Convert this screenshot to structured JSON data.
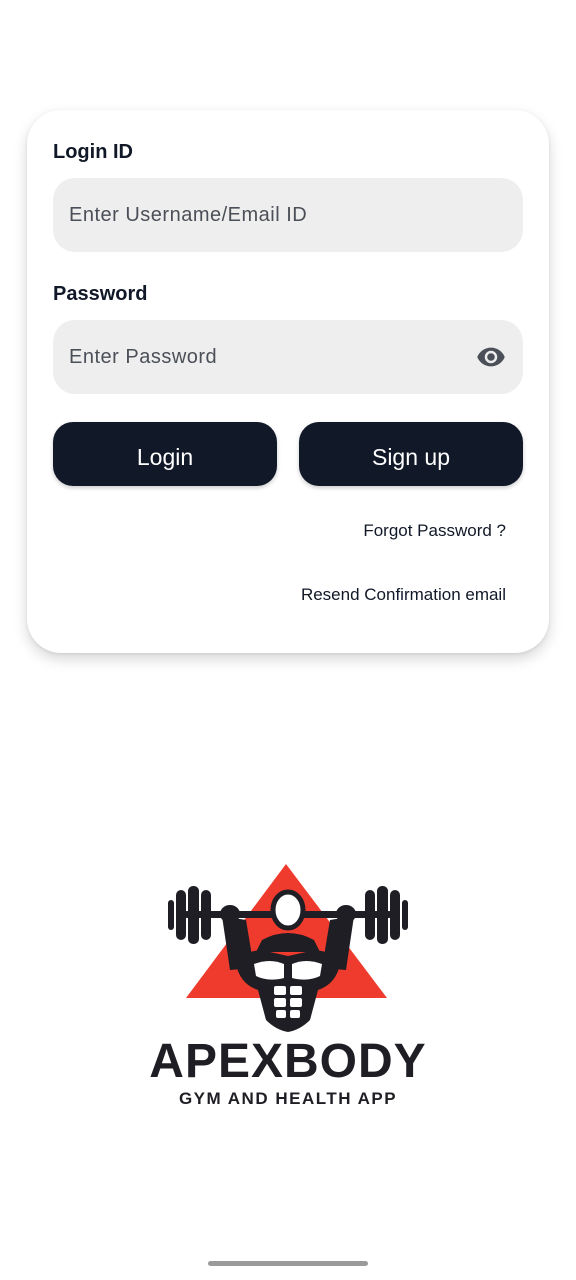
{
  "login_form": {
    "login_id_label": "Login ID",
    "login_id_placeholder": "Enter Username/Email ID",
    "login_id_value": "",
    "password_label": "Password",
    "password_placeholder": "Enter Password",
    "password_value": "",
    "password_toggle_icon": "eye-icon",
    "login_button": "Login",
    "signup_button": "Sign up",
    "forgot_password_link": "Forgot Password ?",
    "resend_link": "Resend Confirmation email"
  },
  "branding": {
    "name": "APEXBODY",
    "tagline": "GYM AND HEALTH APP",
    "logo_icon": "weightlifter-logo-icon"
  },
  "colors": {
    "primary": "#111827",
    "input_bg": "#eeeeee",
    "logo_red": "#ef3b2d",
    "logo_dark": "#1e1e24"
  }
}
